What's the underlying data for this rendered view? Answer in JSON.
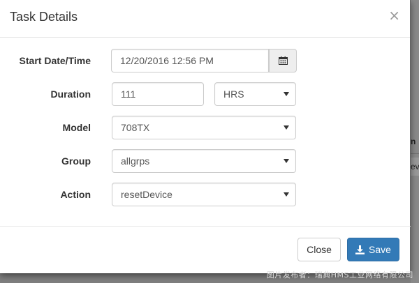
{
  "modal": {
    "title": "Task Details",
    "close_glyph": "×"
  },
  "form": {
    "start": {
      "label": "Start Date/Time",
      "value": "12/20/2016 12:56 PM",
      "icon": "calendar-icon"
    },
    "duration": {
      "label": "Duration",
      "value": "111",
      "unit": "HRS"
    },
    "model": {
      "label": "Model",
      "value": "708TX"
    },
    "group": {
      "label": "Group",
      "value": "allgrps"
    },
    "action": {
      "label": "Action",
      "value": "resetDevice"
    }
  },
  "footer": {
    "close_label": "Close",
    "save_label": "Save",
    "save_icon": "download-icon"
  },
  "colors": {
    "primary": "#337ab7",
    "overlay": "#7f7f7f"
  },
  "background": {
    "row1_text": "n",
    "row2_text": "ev"
  },
  "watermark": "图片发布者：瑞典HMS工业网络有限公司"
}
